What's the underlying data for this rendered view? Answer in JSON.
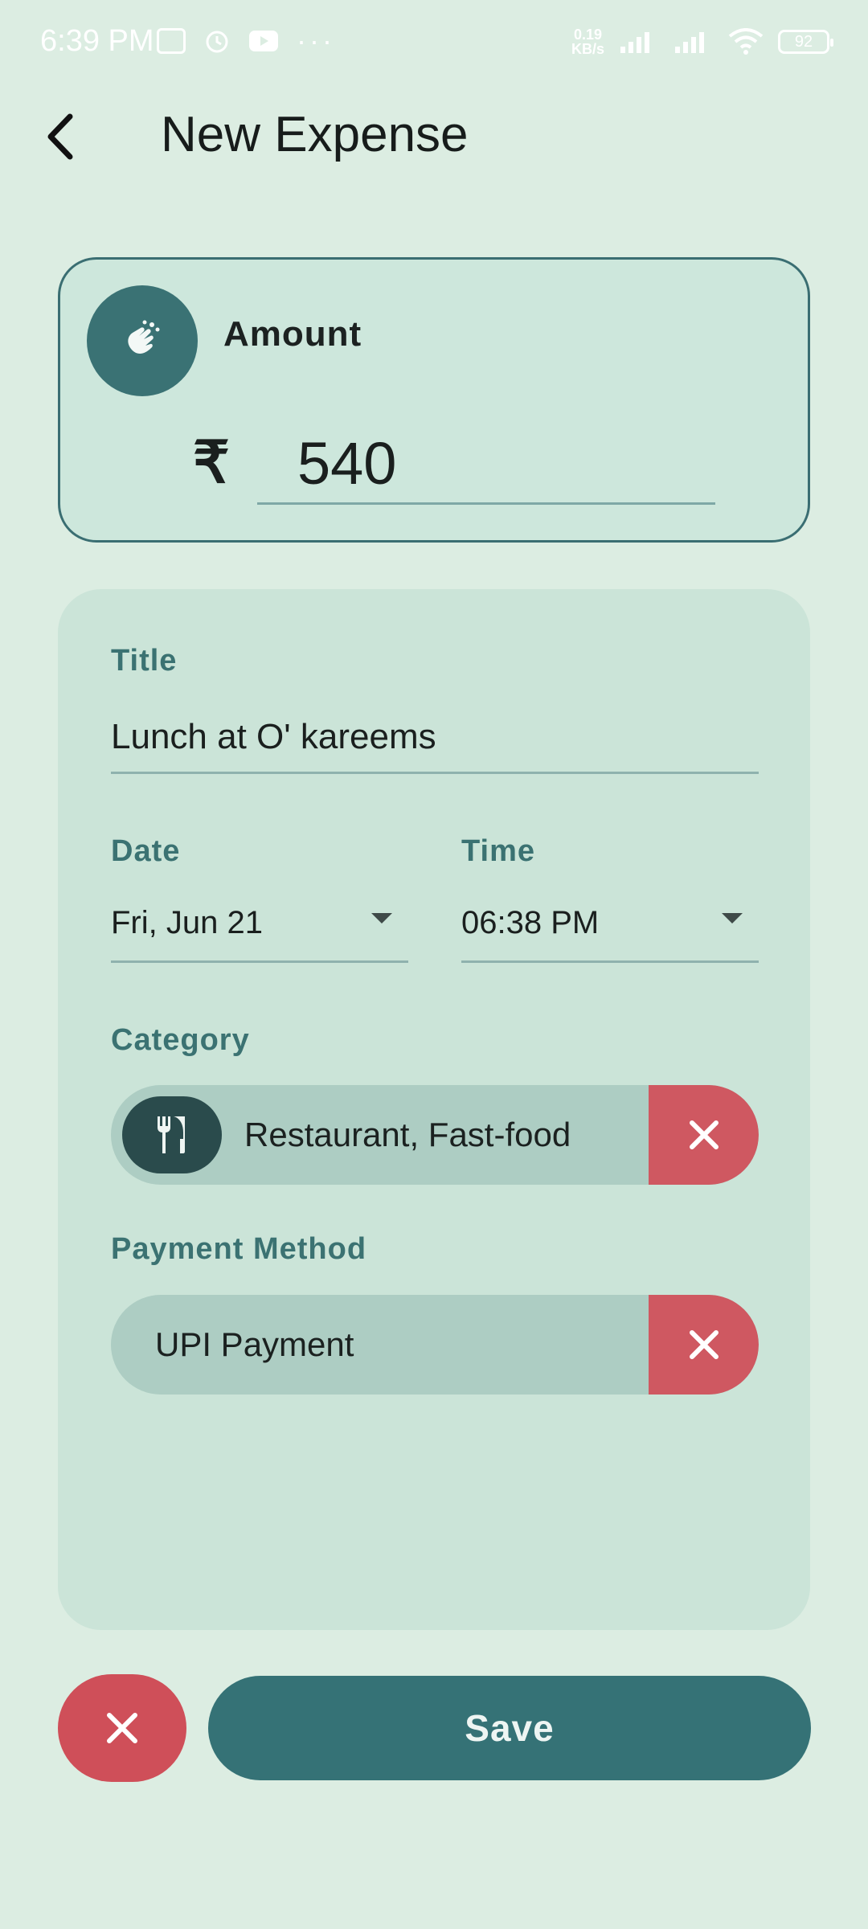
{
  "status_bar": {
    "time": "6:39 PM",
    "net_speed_value": "0.19",
    "net_speed_unit": "KB/s",
    "battery": "92"
  },
  "header": {
    "title": "New Expense"
  },
  "amount": {
    "label": "Amount",
    "currency_symbol": "₹",
    "value": "540"
  },
  "form": {
    "title_label": "Title",
    "title_value": "Lunch at O' kareems",
    "date_label": "Date",
    "date_value": "Fri,  Jun 21",
    "time_label": "Time",
    "time_value": "06:38 PM",
    "category_label": "Category",
    "category_value": "Restaurant, Fast-food",
    "category_icon": "fork-knife-icon",
    "payment_label": "Payment Method",
    "payment_value": "UPI Payment"
  },
  "actions": {
    "save_label": "Save"
  },
  "colors": {
    "background": "#dcede2",
    "accent": "#357276",
    "danger": "#cf5861"
  }
}
